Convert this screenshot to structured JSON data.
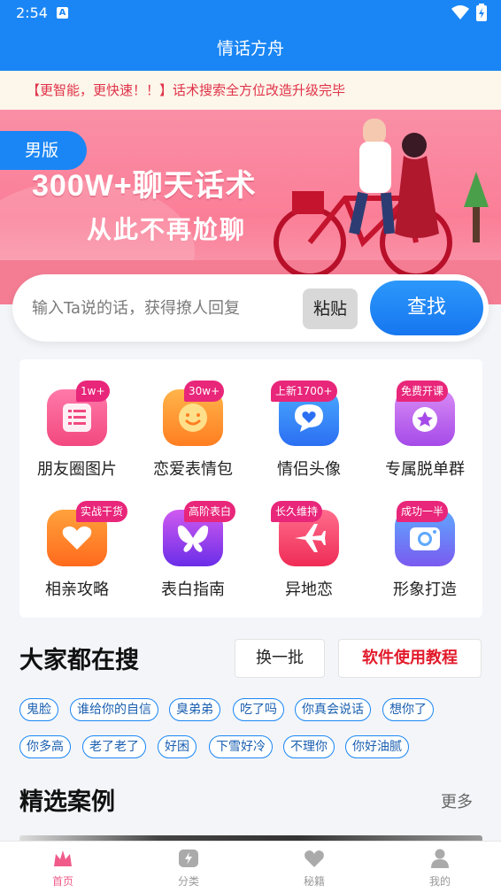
{
  "status_bar": {
    "time": "2:54"
  },
  "app": {
    "title": "情话方舟"
  },
  "notice": {
    "text": "【更智能，更快速！！】话术搜索全方位改造升级完毕"
  },
  "banner": {
    "headline": "300W+聊天话术",
    "subline": "从此不再尬聊",
    "gender_tab": "男版"
  },
  "search": {
    "placeholder": "输入Ta说的话，获得撩人回复",
    "paste_label": "粘贴",
    "find_label": "查找"
  },
  "features": [
    {
      "label": "朋友圈图片",
      "badge": "1w+",
      "icon": "list-icon",
      "color_from": "#ff7aa9",
      "color_to": "#f2487f"
    },
    {
      "label": "恋爱表情包",
      "badge": "30w+",
      "icon": "smiley-icon",
      "color_from": "#ffb44a",
      "color_to": "#ff7e21"
    },
    {
      "label": "情侣头像",
      "badge": "上新1700+",
      "icon": "chat-heart-icon",
      "color_from": "#4aa8ff",
      "color_to": "#2b6ff2"
    },
    {
      "label": "专属脱单群",
      "badge": "免费开课",
      "icon": "medal-icon",
      "color_from": "#d98cf5",
      "color_to": "#a54ae8"
    },
    {
      "label": "相亲攻略",
      "badge": "实战干货",
      "icon": "heart-hand-icon",
      "color_from": "#ffa23c",
      "color_to": "#ff6a1c"
    },
    {
      "label": "表白指南",
      "badge": "高阶表白",
      "icon": "butterfly-icon",
      "color_from": "#d05af0",
      "color_to": "#6a2ee8"
    },
    {
      "label": "异地恋",
      "badge": "长久维持",
      "icon": "airplane-icon",
      "color_from": "#ff6d8c",
      "color_to": "#ef2c56"
    },
    {
      "label": "形象打造",
      "badge": "成功一半",
      "icon": "camera-icon",
      "color_from": "#5fa8ff",
      "color_to": "#7a5af0"
    }
  ],
  "hot_search": {
    "title": "大家都在搜",
    "refresh_label": "换一批",
    "tutorial_label": "软件使用教程",
    "tags": [
      "鬼脸",
      "谁给你的自信",
      "臭弟弟",
      "吃了吗",
      "你真会说话",
      "想你了",
      "你多高",
      "老了老了",
      "好困",
      "下雪好冷",
      "不理你",
      "你好油腻"
    ]
  },
  "cases": {
    "title": "精选案例",
    "more_label": "更多"
  },
  "bottom_nav": [
    {
      "label": "首页",
      "icon": "crown-icon",
      "active": true
    },
    {
      "label": "分类",
      "icon": "category-icon",
      "active": false
    },
    {
      "label": "秘籍",
      "icon": "heart-book-icon",
      "active": false
    },
    {
      "label": "我的",
      "icon": "user-icon",
      "active": false
    }
  ],
  "colors": {
    "primary": "#1a86f5",
    "badge": "#e8267a",
    "notice_text": "#e0334a",
    "tutorial_text": "#e21b2c",
    "nav_active": "#f05b8a"
  }
}
